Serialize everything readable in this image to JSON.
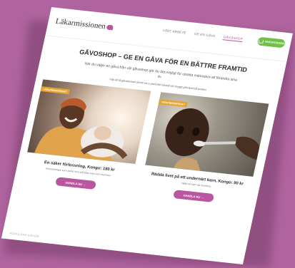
{
  "header": {
    "logo_text": "Läkarmissionen",
    "nav": [
      "VÅRT ARBETE",
      "GE EN GÅVA",
      "GÅVOSHOP"
    ],
    "cart_label": "VARUKORGEN"
  },
  "main": {
    "title": "GÅVOSHOP – GE EN GÅVA FÖR EN BÄTTRE FRAMTID",
    "intro": "När du väljer en gåva från vår gåvoshop gör du det möjligt för utsatta människor att förändra sina liv.",
    "note": "Välj att få gåvobeviset direkt via e-post eller beställ ett snyggt gåvokort på posten."
  },
  "cards": [
    {
      "badge": "HÖGPRIORITERAT",
      "title": "En säker förlossning, Kongo: 180 kr",
      "subtitle": "Förlossningar som deltar livet på både barn och mammor",
      "button": "HANDLA NU →"
    },
    {
      "badge": "HÖGPRIORITERAT",
      "title": "Rädda livet på ett undernärt barn, Kongo: 90 kr",
      "subtitle": "Hjälp ett barn att överleva",
      "button": "HANDLA NU →"
    }
  ],
  "footer": {
    "popular": "POPULÄRA GÅVOR"
  },
  "colors": {
    "brand": "#b8579f",
    "cart": "#6ec046",
    "badge": "#e7a32b",
    "background": "#b0649f"
  }
}
